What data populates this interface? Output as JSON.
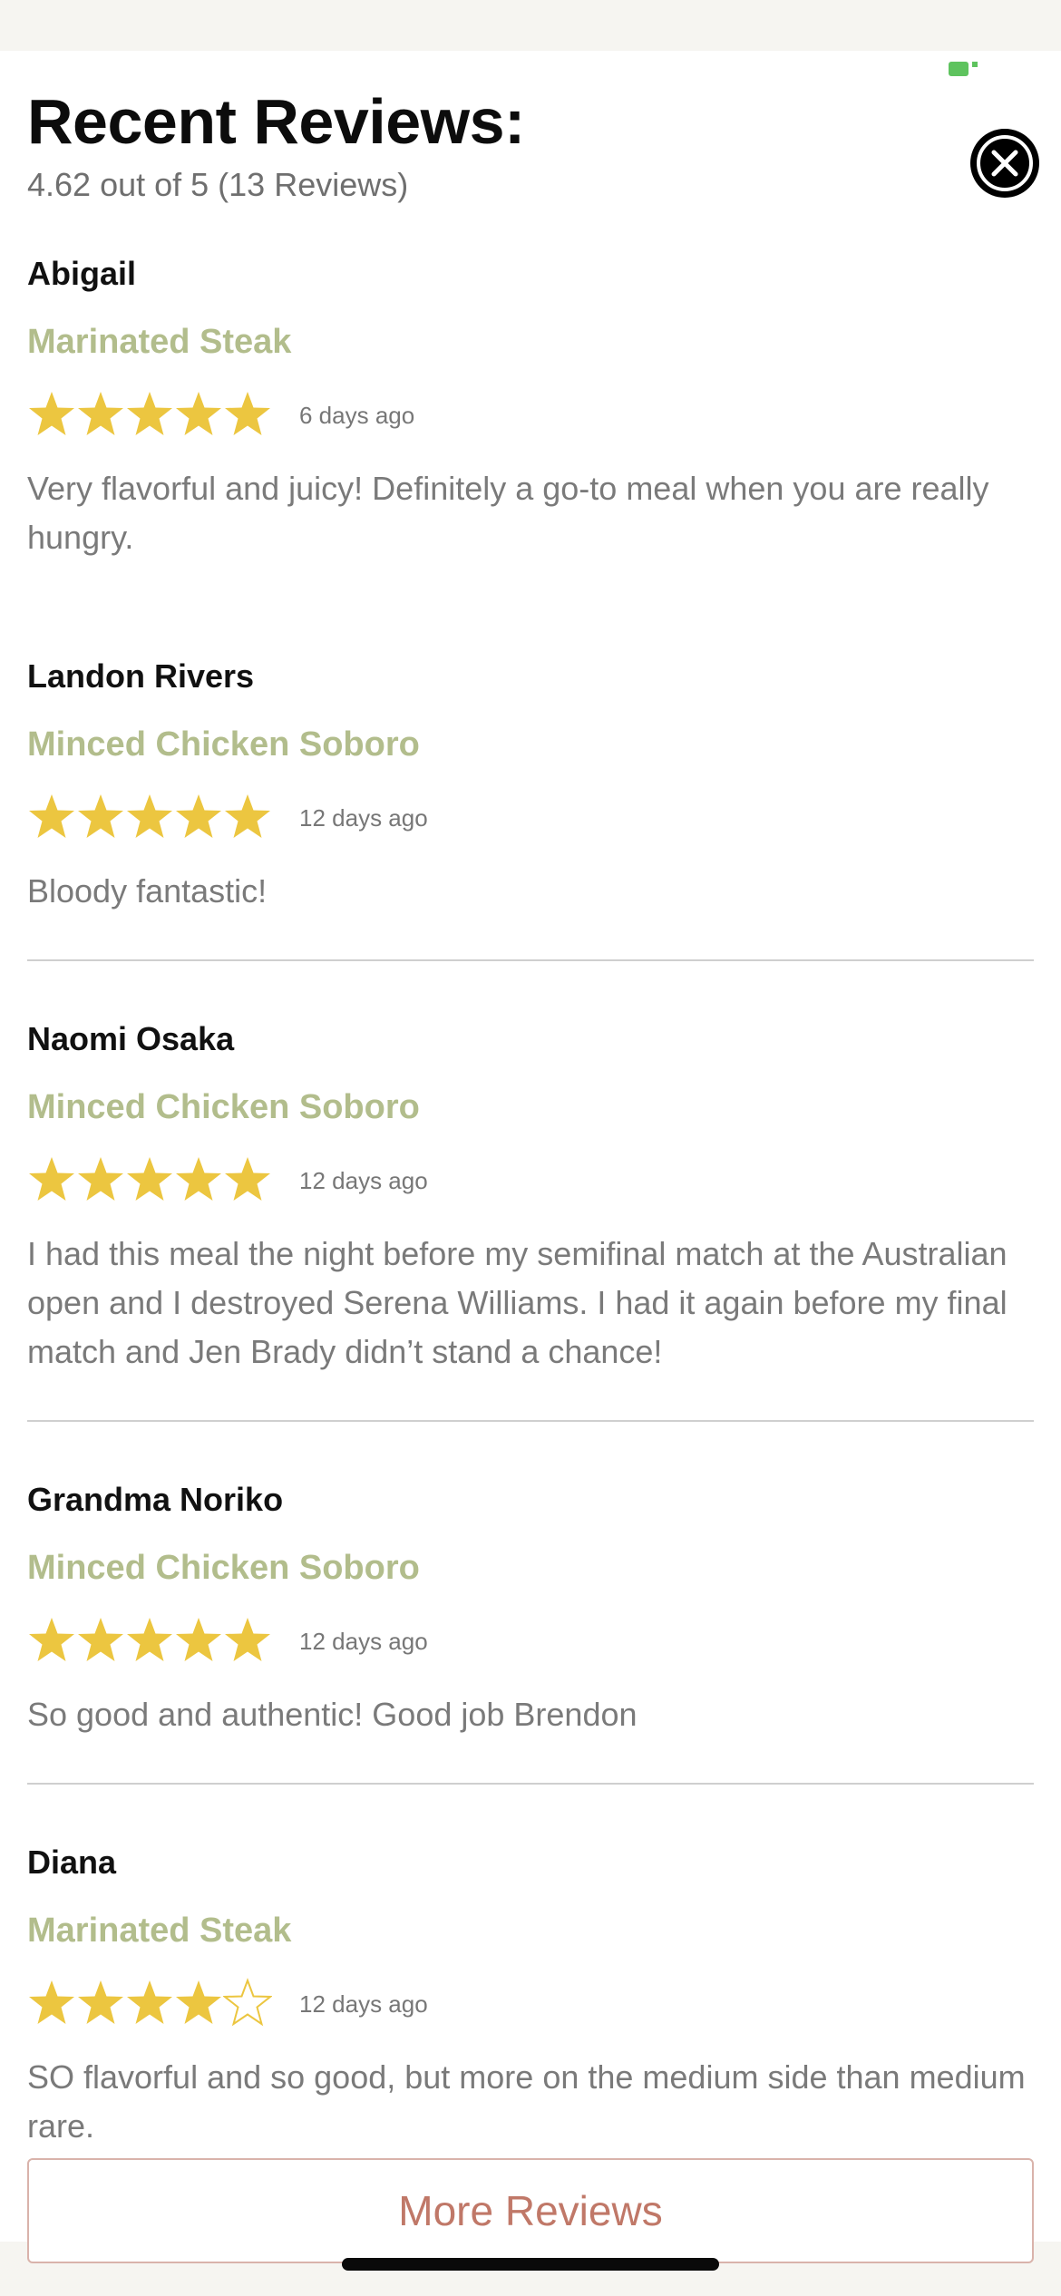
{
  "header": {
    "title": "Recent Reviews:",
    "summary": "4.62 out of 5 (13 Reviews)"
  },
  "reviews": [
    {
      "name": "Abigail",
      "meal": "Marinated Steak",
      "rating": 5,
      "date": "6 days ago",
      "comment": "Very flavorful and juicy! Definitely a go-to meal when you are really hungry."
    },
    {
      "name": "Landon Rivers",
      "meal": "Minced Chicken Soboro",
      "rating": 5,
      "date": "12 days ago",
      "comment": "Bloody fantastic!"
    },
    {
      "name": "Naomi Osaka",
      "meal": "Minced Chicken Soboro",
      "rating": 5,
      "date": "12 days ago",
      "comment": "I had this meal the night before my semifinal match at the Australian open and I destroyed Serena Williams. I had it again before my final match and Jen Brady didn’t stand a chance!"
    },
    {
      "name": "Grandma Noriko",
      "meal": "Minced Chicken Soboro",
      "rating": 5,
      "date": "12 days ago",
      "comment": "So good and authentic! Good job Brendon"
    },
    {
      "name": "Diana",
      "meal": "Marinated Steak",
      "rating": 4,
      "date": "12 days ago",
      "comment": "SO flavorful and so good, but more on the medium side than medium rare."
    }
  ],
  "more_button": "More Reviews",
  "colors": {
    "star": "#ecc640",
    "meal": "#b2bd8c",
    "accent_button": "#c07868"
  },
  "icons": {
    "close": "close-icon",
    "star": "star-icon"
  }
}
